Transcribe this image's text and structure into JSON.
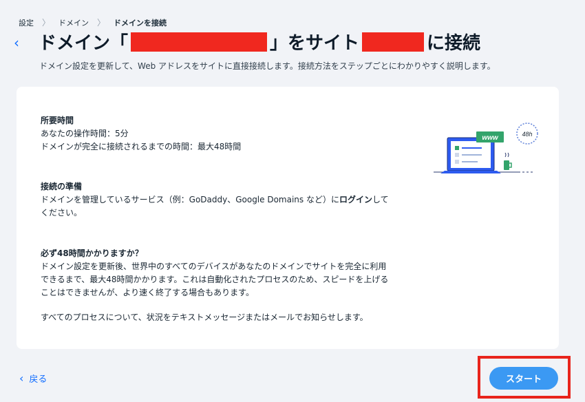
{
  "breadcrumb": {
    "items": [
      "設定",
      "ドメイン",
      "ドメインを接続"
    ]
  },
  "header": {
    "title_part1": "ドメイン「",
    "title_part2": "」をサイト",
    "title_part3": "に接続",
    "subtitle": "ドメイン設定を更新して、Web アドレスをサイトに直接接続します。接続方法をステップごとにわかりやすく説明します。"
  },
  "card": {
    "time": {
      "heading": "所要時間",
      "line1": "あなたの操作時間：5分",
      "line2": "ドメインが完全に接続されるまでの時間：最大48時間"
    },
    "prep": {
      "heading": "接続の準備",
      "text_before": "ドメインを管理しているサービス（例：GoDaddy、Google Domains など）に",
      "text_bold": "ログイン",
      "text_after": "して",
      "line2": "ください。"
    },
    "faq": {
      "heading": "必ず48時間かかりますか？",
      "line1": "ドメイン設定を更新後、世界中のすべてのデバイスがあなたのドメインでサイトを完全に利用",
      "line2": "できるまで、最大48時間かかります。これは自動化されたプロセスのため、スピードを上げる",
      "line3": "ことはできませんが、より速く終了する場合もあります。",
      "note": "すべてのプロセスについて、状況をテキストメッセージまたはメールでお知らせします。"
    },
    "illustration": {
      "www_label": "www",
      "clock_label": "48h"
    }
  },
  "footer": {
    "back_label": "戻る",
    "start_label": "スタート"
  },
  "colors": {
    "accent": "#116dff",
    "start_button": "#3b99f3",
    "highlight": "#e8241c",
    "redaction": "#f0281f"
  }
}
